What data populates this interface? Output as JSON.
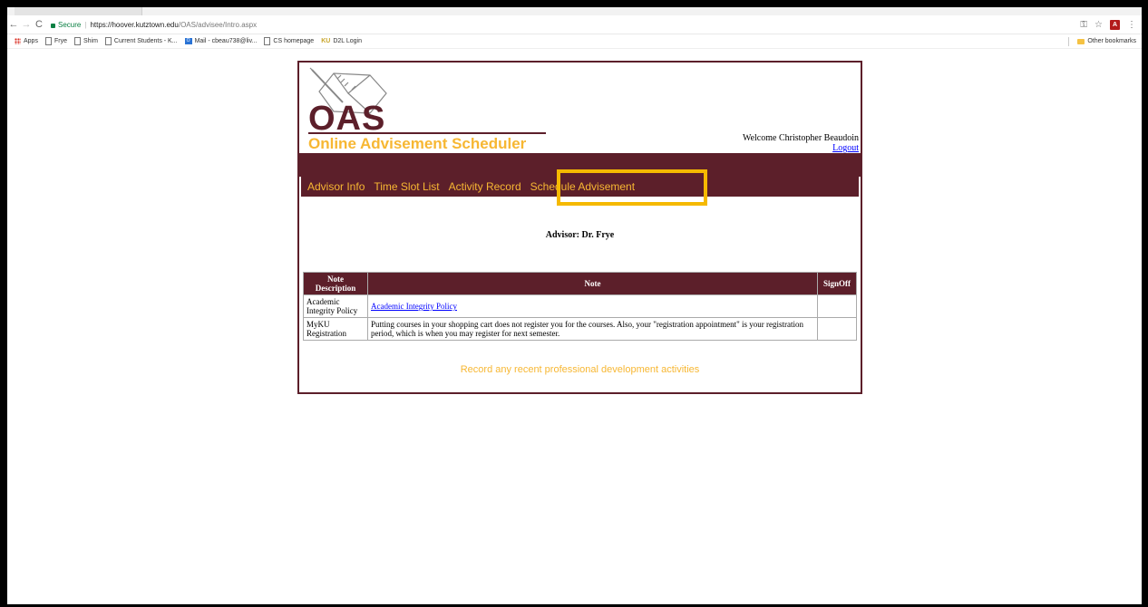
{
  "browser": {
    "secure_label": "Secure",
    "url_host": "https://hoover.kutztown.edu",
    "url_path": "/OAS/advisee/Intro.aspx",
    "bookmarks": [
      "Apps",
      "Frye",
      "Shim",
      "Current Students - K...",
      "Mail - cbeau738@liv...",
      "CS homepage",
      "D2L Login"
    ],
    "other_bookmarks": "Other bookmarks"
  },
  "header": {
    "logo": "OAS",
    "subtitle": "Online Advisement Scheduler",
    "welcome": "Welcome Christopher Beaudoin",
    "logout": "Logout"
  },
  "menu": [
    "Advisor Info",
    "Time Slot List",
    "Activity Record",
    "Schedule Advisement"
  ],
  "advisor_line": "Advisor: Dr. Frye",
  "table": {
    "headers": [
      "Note Description",
      "Note",
      "SignOff"
    ],
    "rows": [
      {
        "description": "Academic Integrity Policy",
        "note": "Academic Integrity Policy",
        "note_is_link": true,
        "signoff": ""
      },
      {
        "description": "MyKU Registration",
        "note": "Putting courses in your shopping cart does not register you for the courses. Also, your \"registration appointment\" is your registration period, which is when you may register for next semester.",
        "note_is_link": false,
        "signoff": ""
      }
    ]
  },
  "pd_link": "Record any recent professional development activities",
  "colors": {
    "maroon": "#5c1f2a",
    "gold": "#f7b733",
    "highlight": "#f5b900"
  }
}
